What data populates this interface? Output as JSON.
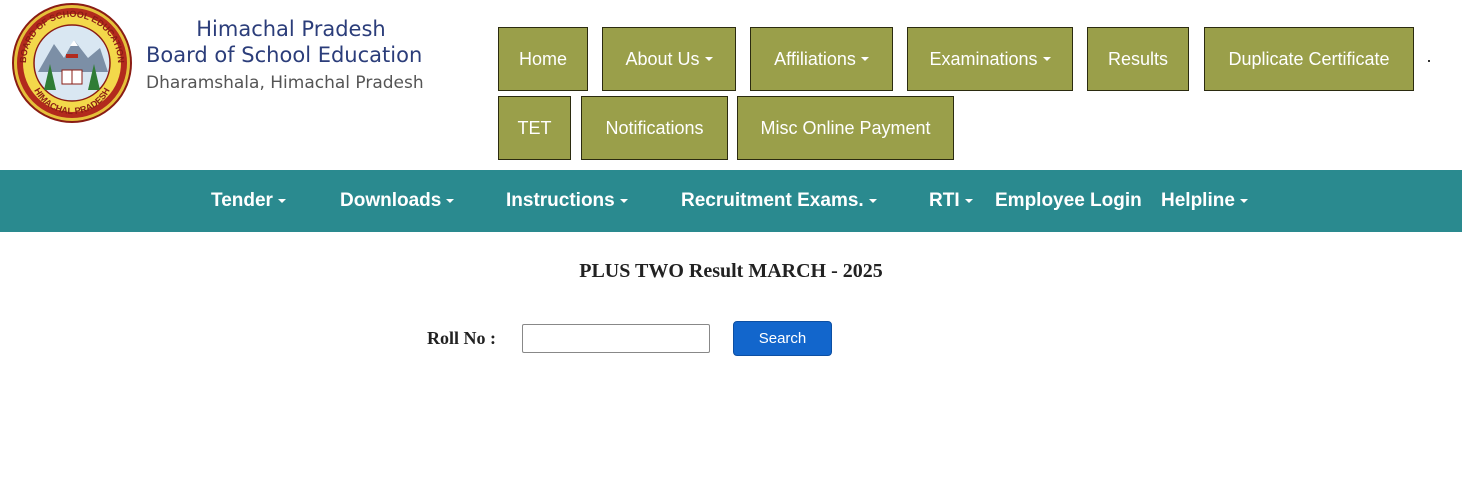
{
  "header": {
    "brand_line1": "Himachal Pradesh",
    "brand_line2": "Board of School Education",
    "brand_line3": "Dharamshala, Himachal Pradesh",
    "logo_top_text": "BOARD OF SCHOOL EDUCATION",
    "logo_bottom_text": "HIMACHAL PRADESH"
  },
  "top_nav": {
    "items": [
      {
        "label": "Home",
        "dropdown": false
      },
      {
        "label": "About Us",
        "dropdown": true
      },
      {
        "label": "Affiliations",
        "dropdown": true
      },
      {
        "label": "Examinations",
        "dropdown": true
      },
      {
        "label": "Results",
        "dropdown": false
      },
      {
        "label": "Duplicate Certificate",
        "dropdown": false
      },
      {
        "label": "TET",
        "dropdown": false
      },
      {
        "label": "Notifications",
        "dropdown": false
      },
      {
        "label": "Misc Online Payment",
        "dropdown": false
      }
    ],
    "color": "#9a9f4a"
  },
  "secondary_nav": {
    "items": [
      {
        "label": "Tender",
        "dropdown": true
      },
      {
        "label": "Downloads",
        "dropdown": true
      },
      {
        "label": "Instructions",
        "dropdown": true
      },
      {
        "label": "Recruitment Exams.",
        "dropdown": true
      },
      {
        "label": "RTI",
        "dropdown": true
      },
      {
        "label": "Employee Login",
        "dropdown": false
      },
      {
        "label": "Helpline",
        "dropdown": true
      }
    ],
    "color": "#2a8a8f"
  },
  "main": {
    "title": "PLUS TWO Result MARCH - 2025",
    "roll_label": "Roll No :",
    "roll_value": "",
    "search_label": "Search",
    "search_color": "#1266cc"
  }
}
